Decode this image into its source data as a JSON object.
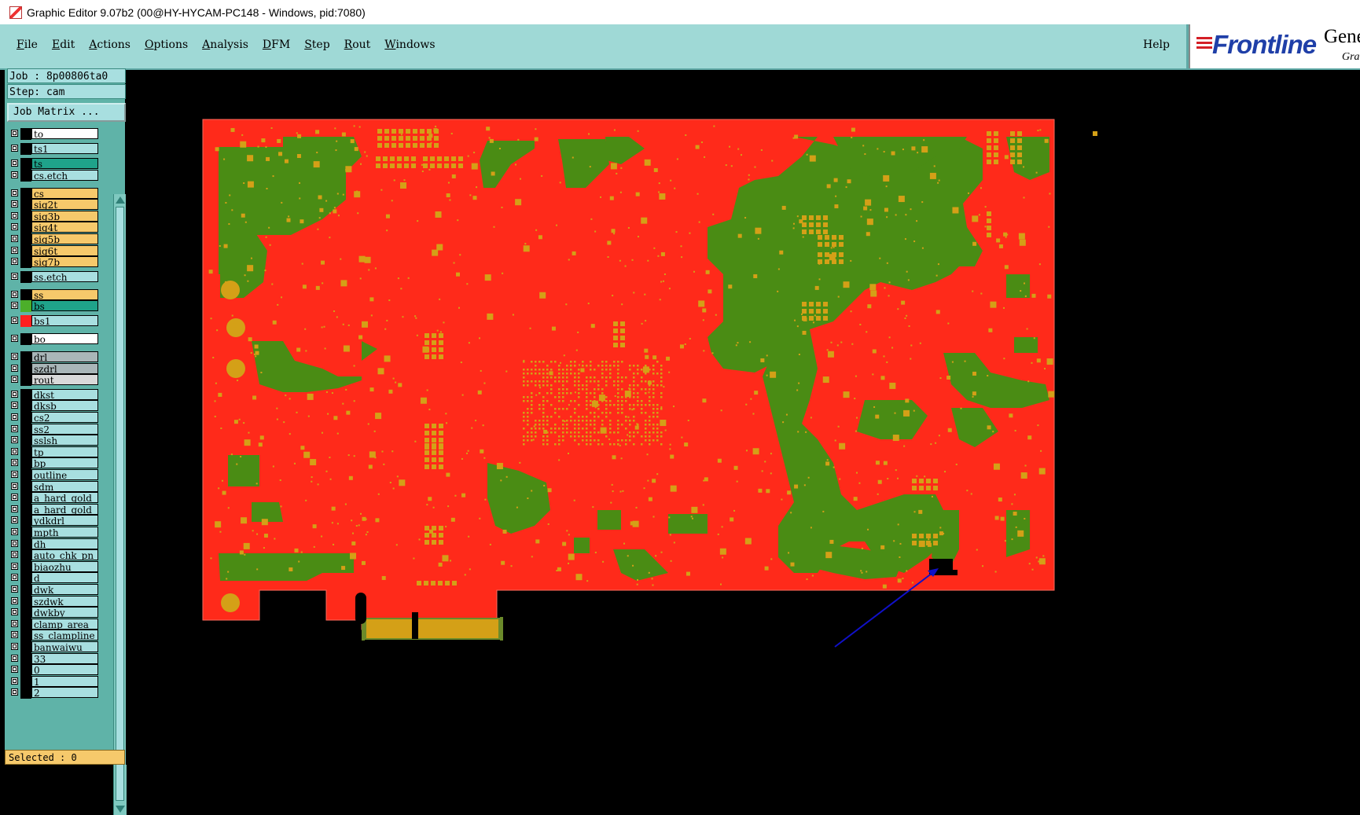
{
  "window": {
    "title": "Graphic Editor 9.07b2 (00@HY-HYCAM-PC148 - Windows, pid:7080)"
  },
  "menu": {
    "items": [
      "File",
      "Edit",
      "Actions",
      "Options",
      "Analysis",
      "DFM",
      "Step",
      "Rout",
      "Windows"
    ],
    "help": "Help"
  },
  "logo": {
    "brand": "Frontline",
    "gene": "Gene",
    "gra": "Gra"
  },
  "job": {
    "label": "Job : 8p00806ta0",
    "step": "Step: cam",
    "matrix_button": "Job Matrix ..."
  },
  "layers": [
    {
      "name": "to",
      "color": "#ffffff",
      "swatch": "#000000"
    },
    {
      "name": "ts1",
      "color": "#a8dfe0",
      "swatch": "#000000"
    },
    {
      "name": "ts",
      "color": "#1fa38a",
      "swatch": "#000000"
    },
    {
      "name": "cs.etch",
      "color": "#a8dfe0",
      "swatch": "#000000"
    },
    {
      "name": "cs",
      "color": "#f6c96b",
      "swatch": "#000000"
    },
    {
      "name": "sig2t",
      "color": "#f6c96b",
      "swatch": "#000000"
    },
    {
      "name": "sig3b",
      "color": "#f6c96b",
      "swatch": "#000000"
    },
    {
      "name": "sig4t",
      "color": "#f6c96b",
      "swatch": "#000000"
    },
    {
      "name": "sig5b",
      "color": "#f6c96b",
      "swatch": "#000000"
    },
    {
      "name": "sig6t",
      "color": "#f6c96b",
      "swatch": "#000000"
    },
    {
      "name": "sig7b",
      "color": "#f6c96b",
      "swatch": "#000000"
    },
    {
      "name": "ss.etch",
      "color": "#a8dfe0",
      "swatch": "#000000"
    },
    {
      "name": "ss",
      "color": "#f6c96b",
      "swatch": "#000000"
    },
    {
      "name": "bs",
      "color": "#1fa38a",
      "swatch": "#4caf2a"
    },
    {
      "name": "bs1",
      "color": "#a8dfe0",
      "swatch": "#ff2020"
    },
    {
      "name": "bo",
      "color": "#ffffff",
      "swatch": "#000000"
    },
    {
      "name": "drl",
      "color": "#a9b6b8",
      "swatch": "#000000"
    },
    {
      "name": "szdrl",
      "color": "#a9b6b8",
      "swatch": "#000000"
    },
    {
      "name": "rout",
      "color": "#d9d9d9",
      "swatch": "#000000"
    },
    {
      "name": "dkst",
      "color": "#a8dfe0",
      "swatch": "#000000"
    },
    {
      "name": "dksb",
      "color": "#a8dfe0",
      "swatch": "#000000"
    },
    {
      "name": "cs2",
      "color": "#a8dfe0",
      "swatch": "#000000"
    },
    {
      "name": "ss2",
      "color": "#a8dfe0",
      "swatch": "#000000"
    },
    {
      "name": "sslsh",
      "color": "#a8dfe0",
      "swatch": "#000000"
    },
    {
      "name": "tp",
      "color": "#a8dfe0",
      "swatch": "#000000"
    },
    {
      "name": "bp",
      "color": "#a8dfe0",
      "swatch": "#000000"
    },
    {
      "name": "outline",
      "color": "#a8dfe0",
      "swatch": "#000000"
    },
    {
      "name": "sdm",
      "color": "#a8dfe0",
      "swatch": "#000000"
    },
    {
      "name": "a_hard_gold",
      "color": "#a8dfe0",
      "swatch": "#000000"
    },
    {
      "name": "a_hard_gold",
      "color": "#a8dfe0",
      "swatch": "#000000"
    },
    {
      "name": "ydkdrl",
      "color": "#a8dfe0",
      "swatch": "#000000"
    },
    {
      "name": "mpth",
      "color": "#a8dfe0",
      "swatch": "#000000"
    },
    {
      "name": "dh",
      "color": "#a8dfe0",
      "swatch": "#000000"
    },
    {
      "name": "auto_chk_pn",
      "color": "#a8dfe0",
      "swatch": "#000000"
    },
    {
      "name": "biaozhu",
      "color": "#a8dfe0",
      "swatch": "#000000"
    },
    {
      "name": "d",
      "color": "#a8dfe0",
      "swatch": "#000000"
    },
    {
      "name": "dwk",
      "color": "#a8dfe0",
      "swatch": "#000000"
    },
    {
      "name": "szdwk",
      "color": "#a8dfe0",
      "swatch": "#000000"
    },
    {
      "name": "dwkby",
      "color": "#a8dfe0",
      "swatch": "#000000"
    },
    {
      "name": "clamp_area",
      "color": "#a8dfe0",
      "swatch": "#000000"
    },
    {
      "name": "ss_clampline",
      "color": "#a8dfe0",
      "swatch": "#000000"
    },
    {
      "name": "banwaiwu",
      "color": "#a8dfe0",
      "swatch": "#000000"
    },
    {
      "name": "33",
      "color": "#a8dfe0",
      "swatch": "#000000"
    },
    {
      "name": "0",
      "color": "#a8dfe0",
      "swatch": "#000000"
    },
    {
      "name": "1",
      "color": "#a8dfe0",
      "swatch": "#000000"
    },
    {
      "name": "2",
      "color": "#a8dfe0",
      "swatch": "#000000"
    }
  ],
  "status": {
    "selected": "Selected : 0"
  },
  "colors": {
    "board_red": "#ff2a1a",
    "copper_green": "#4a8c14",
    "pad_gold": "#d4a017",
    "highlight_black": "#000000",
    "arrow_blue": "#1010c8"
  }
}
